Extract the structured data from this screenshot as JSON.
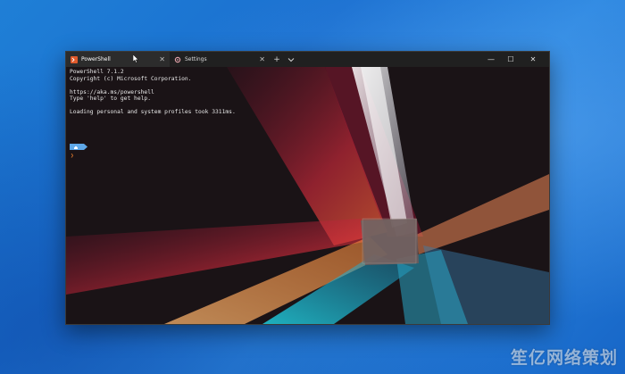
{
  "tabs": [
    {
      "label": "PowerShell",
      "icon": "powershell-icon",
      "active": true
    },
    {
      "label": "Settings",
      "icon": "gear-icon",
      "active": false
    }
  ],
  "titlebar": {
    "new_tab": "+",
    "dropdown_icon": "chevron-down-icon",
    "minimize": "—",
    "maximize": "☐",
    "close": "✕"
  },
  "terminal": {
    "lines": [
      "PowerShell 7.1.2",
      "Copyright (c) Microsoft Corporation.",
      "",
      "https://aka.ms/powershell",
      "Type 'help' to get help.",
      "",
      "Loading personal and system profiles took 3311ms."
    ],
    "prompt_arrow": "❯"
  },
  "watermark": "笙亿网络策划",
  "colors": {
    "desktop": "#1f7fd6",
    "terminal_bg": "#1a1316",
    "prompt_badge": "#5fa8e8",
    "prompt_arrow": "#e77c2e"
  }
}
